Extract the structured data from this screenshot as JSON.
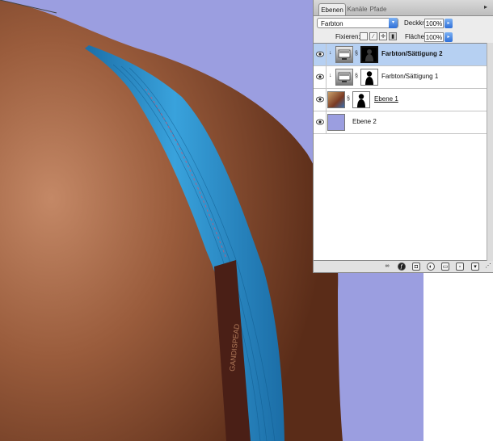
{
  "window": {
    "palette": "layers"
  },
  "tabs": [
    {
      "label": "Ebenen",
      "active": true
    },
    {
      "label": "Kanäle",
      "active": false
    },
    {
      "label": "Pfade",
      "active": false
    }
  ],
  "blend_mode": {
    "value": "Farbton"
  },
  "opacity": {
    "label": "Deckkr.:",
    "value": "100%"
  },
  "lock": {
    "label": "Fixieren:"
  },
  "fill": {
    "label": "Fläche:",
    "value": "100%"
  },
  "layers": [
    {
      "name": "Farbton/Sättigung 2",
      "selected": true,
      "bold": true,
      "underline": false,
      "kind": "adjustment",
      "mask": "black-silhouette"
    },
    {
      "name": "Farbton/Sättigung 1",
      "selected": false,
      "bold": false,
      "underline": false,
      "kind": "adjustment",
      "mask": "white-silhouette"
    },
    {
      "name": "Ebene 1",
      "selected": false,
      "bold": false,
      "underline": true,
      "kind": "photo",
      "mask": "white-silhouette"
    },
    {
      "name": "Ebene 2",
      "selected": false,
      "bold": false,
      "underline": false,
      "kind": "fill",
      "fill_color": "#9b9ee0"
    }
  ],
  "bottom_icons": [
    "link-icon",
    "fx-icon",
    "mask-icon",
    "adjustment-icon",
    "folder-icon",
    "new-layer-icon",
    "trash-icon"
  ],
  "colors": {
    "background": "#9b9ee0",
    "selection": "#b6d0f2",
    "strap": "#2b92cf"
  },
  "photo": {
    "strap_text": "GANDISPEAD"
  }
}
